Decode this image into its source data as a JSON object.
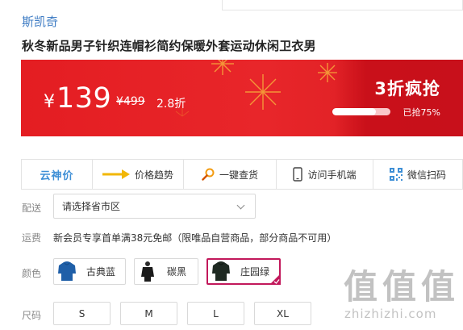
{
  "product": {
    "brand": "斯凯奇",
    "title": "秋冬新品男子针织连帽衫简约保暖外套运动休闲卫衣男"
  },
  "price": {
    "currency": "¥",
    "current": "139",
    "original": "¥499",
    "discount": "2.8折"
  },
  "flash_sale": {
    "title": "3折疯抢",
    "sold_text": "已抢75%",
    "progress": 0.75
  },
  "toolbar": {
    "items": [
      {
        "label": "云神价",
        "icon": "brand-logo"
      },
      {
        "label": "价格趋势",
        "icon": "arrow-right-icon"
      },
      {
        "label": "一键查货",
        "icon": "magnifier-icon"
      },
      {
        "label": "访问手机端",
        "icon": "mobile-phone-icon"
      },
      {
        "label": "微信扫码",
        "icon": "qr-code-icon"
      }
    ]
  },
  "delivery": {
    "label": "配送",
    "placeholder": "请选择省市区"
  },
  "shipping": {
    "label": "运费",
    "text": "新会员专享首单满38元免邮（限唯品自营商品，部分商品不可用）"
  },
  "color": {
    "label": "颜色",
    "options": [
      {
        "name": "古典蓝",
        "swatch": "#1f5fa8"
      },
      {
        "name": "碳黑",
        "swatch": "#1b1b1b"
      },
      {
        "name": "庄园绿",
        "swatch": "#1f2a22"
      }
    ],
    "selected": "庄园绿",
    "selected_color": "#c2185b"
  },
  "size": {
    "label": "尺码",
    "options": [
      "S",
      "M",
      "L",
      "XL"
    ]
  },
  "watermark": {
    "main": "值值值",
    "site": "zhizhizhi.com"
  },
  "colors": {
    "banner_red": "#e41d22",
    "link_blue": "#3e7cc4"
  }
}
